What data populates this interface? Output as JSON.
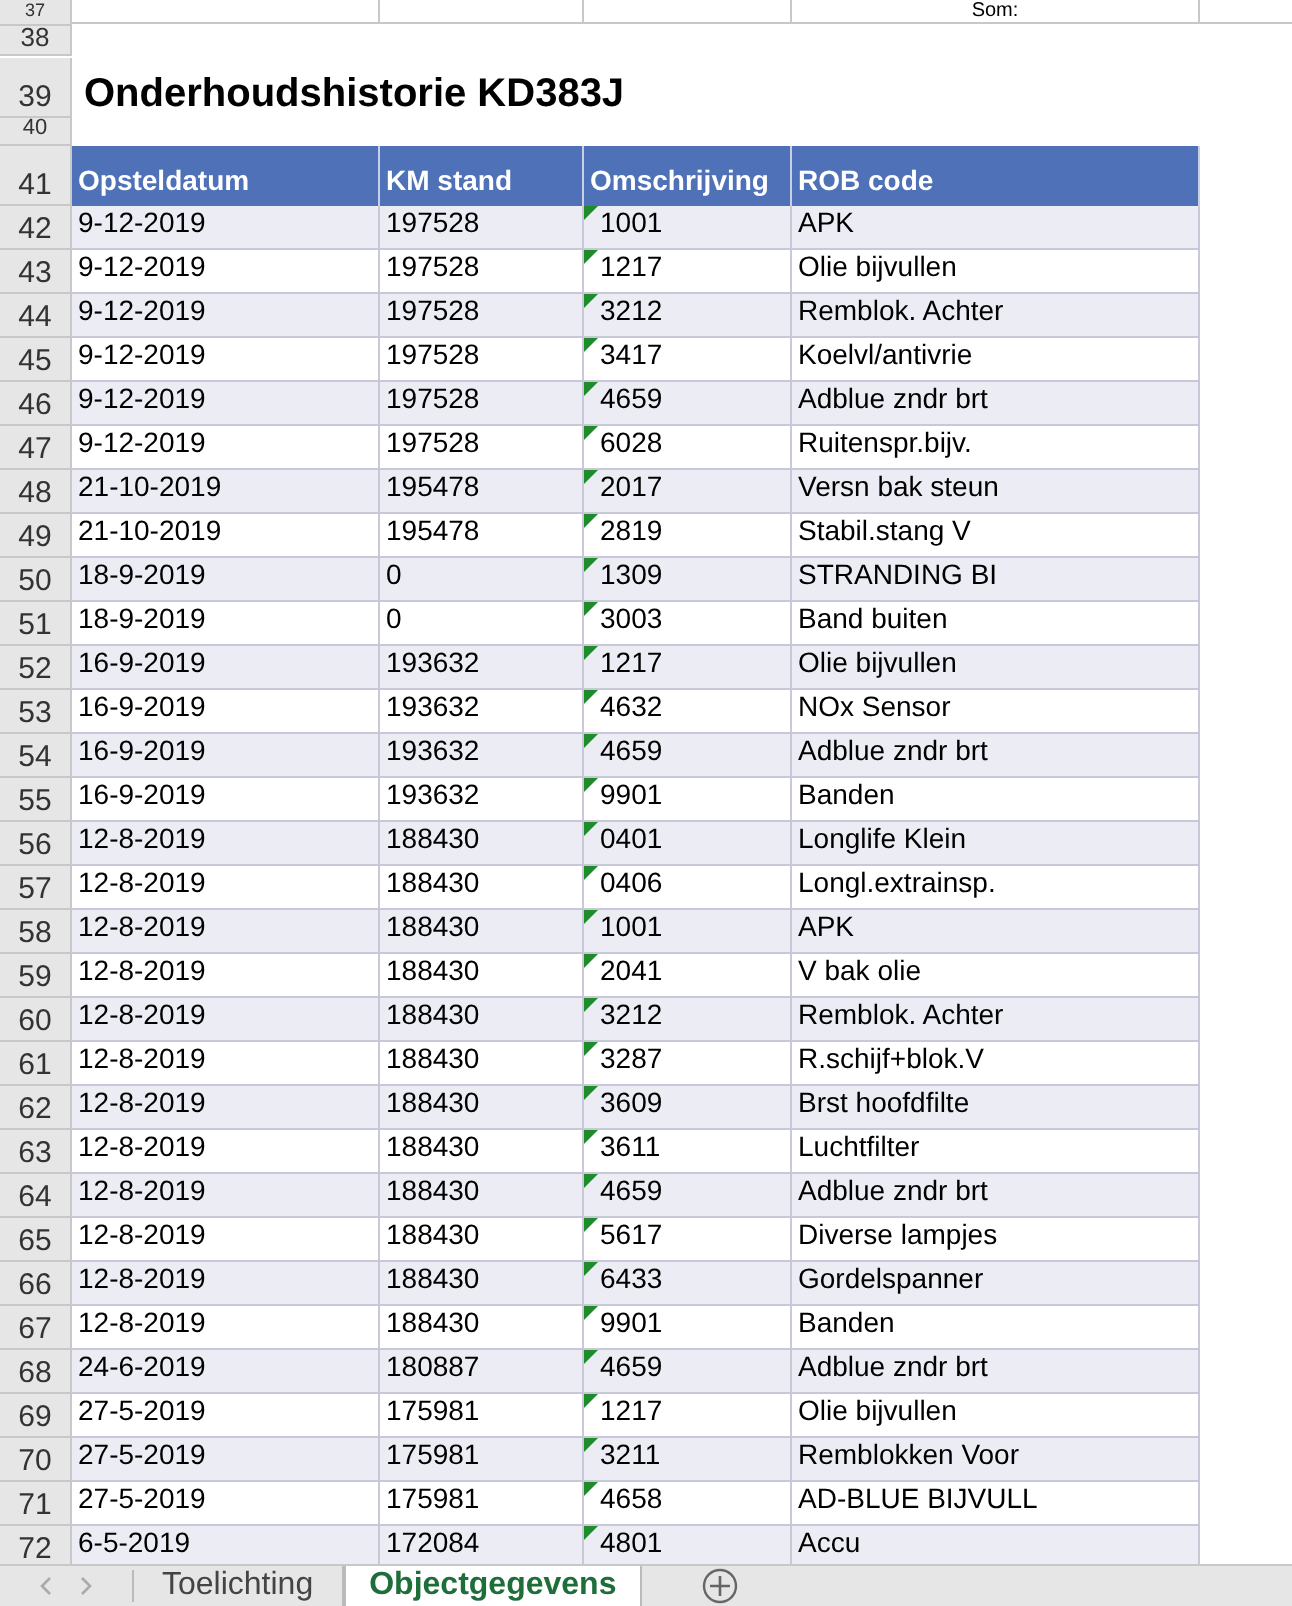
{
  "sheet": {
    "top_rows": [
      {
        "row": "37",
        "cells": [
          "",
          "",
          "",
          "Som:",
          "",
          ""
        ]
      },
      {
        "row": "38"
      }
    ],
    "title": {
      "row": "39",
      "text": "Onderhoudshistorie KD383J"
    },
    "spacer_row": "40",
    "header": {
      "row": "41",
      "columns": [
        "Opsteldatum",
        "KM stand",
        "Omschrijving",
        "ROB code"
      ]
    },
    "rows": [
      {
        "row": "42",
        "date": "9-12-2019",
        "km": "197528",
        "code": "1001",
        "rob": "APK",
        "flagged": true
      },
      {
        "row": "43",
        "date": "9-12-2019",
        "km": "197528",
        "code": "1217",
        "rob": "Olie bijvullen",
        "flagged": true
      },
      {
        "row": "44",
        "date": "9-12-2019",
        "km": "197528",
        "code": "3212",
        "rob": "Remblok. Achter",
        "flagged": true
      },
      {
        "row": "45",
        "date": "9-12-2019",
        "km": "197528",
        "code": "3417",
        "rob": "Koelvl/antivrie",
        "flagged": true
      },
      {
        "row": "46",
        "date": "9-12-2019",
        "km": "197528",
        "code": "4659",
        "rob": "Adblue zndr brt",
        "flagged": true
      },
      {
        "row": "47",
        "date": "9-12-2019",
        "km": "197528",
        "code": "6028",
        "rob": "Ruitenspr.bijv.",
        "flagged": true
      },
      {
        "row": "48",
        "date": "21-10-2019",
        "km": "195478",
        "code": "2017",
        "rob": "Versn bak steun",
        "flagged": true
      },
      {
        "row": "49",
        "date": "21-10-2019",
        "km": "195478",
        "code": "2819",
        "rob": "Stabil.stang V",
        "flagged": true
      },
      {
        "row": "50",
        "date": "18-9-2019",
        "km": "0",
        "code": "1309",
        "rob": "STRANDING BI",
        "flagged": true
      },
      {
        "row": "51",
        "date": "18-9-2019",
        "km": "0",
        "code": "3003",
        "rob": "Band buiten",
        "flagged": true
      },
      {
        "row": "52",
        "date": "16-9-2019",
        "km": "193632",
        "code": "1217",
        "rob": "Olie bijvullen",
        "flagged": true
      },
      {
        "row": "53",
        "date": "16-9-2019",
        "km": "193632",
        "code": "4632",
        "rob": "NOx Sensor",
        "flagged": true
      },
      {
        "row": "54",
        "date": "16-9-2019",
        "km": "193632",
        "code": "4659",
        "rob": "Adblue zndr brt",
        "flagged": true
      },
      {
        "row": "55",
        "date": "16-9-2019",
        "km": "193632",
        "code": "9901",
        "rob": "Banden",
        "flagged": true
      },
      {
        "row": "56",
        "date": "12-8-2019",
        "km": "188430",
        "code": "0401",
        "rob": "Longlife Klein",
        "flagged": true
      },
      {
        "row": "57",
        "date": "12-8-2019",
        "km": "188430",
        "code": "0406",
        "rob": "Longl.extrainsp.",
        "flagged": true
      },
      {
        "row": "58",
        "date": "12-8-2019",
        "km": "188430",
        "code": "1001",
        "rob": "APK",
        "flagged": true
      },
      {
        "row": "59",
        "date": "12-8-2019",
        "km": "188430",
        "code": "2041",
        "rob": "V bak olie",
        "flagged": true
      },
      {
        "row": "60",
        "date": "12-8-2019",
        "km": "188430",
        "code": "3212",
        "rob": "Remblok. Achter",
        "flagged": true
      },
      {
        "row": "61",
        "date": "12-8-2019",
        "km": "188430",
        "code": "3287",
        "rob": "R.schijf+blok.V",
        "flagged": true
      },
      {
        "row": "62",
        "date": "12-8-2019",
        "km": "188430",
        "code": "3609",
        "rob": "Brst hoofdfilte",
        "flagged": true
      },
      {
        "row": "63",
        "date": "12-8-2019",
        "km": "188430",
        "code": "3611",
        "rob": "Luchtfilter",
        "flagged": true
      },
      {
        "row": "64",
        "date": "12-8-2019",
        "km": "188430",
        "code": "4659",
        "rob": "Adblue zndr brt",
        "flagged": true
      },
      {
        "row": "65",
        "date": "12-8-2019",
        "km": "188430",
        "code": "5617",
        "rob": "Diverse lampjes",
        "flagged": true
      },
      {
        "row": "66",
        "date": "12-8-2019",
        "km": "188430",
        "code": "6433",
        "rob": "Gordelspanner",
        "flagged": true
      },
      {
        "row": "67",
        "date": "12-8-2019",
        "km": "188430",
        "code": "9901",
        "rob": "Banden",
        "flagged": true
      },
      {
        "row": "68",
        "date": "24-6-2019",
        "km": "180887",
        "code": "4659",
        "rob": "Adblue zndr brt",
        "flagged": true
      },
      {
        "row": "69",
        "date": "27-5-2019",
        "km": "175981",
        "code": "1217",
        "rob": "Olie bijvullen",
        "flagged": true
      },
      {
        "row": "70",
        "date": "27-5-2019",
        "km": "175981",
        "code": "3211",
        "rob": "Remblokken Voor",
        "flagged": true
      },
      {
        "row": "71",
        "date": "27-5-2019",
        "km": "175981",
        "code": "4658",
        "rob": "AD-BLUE BIJVULL",
        "flagged": true
      },
      {
        "row": "72",
        "date": "6-5-2019",
        "km": "172084",
        "code": "4801",
        "rob": "Accu",
        "flagged": true
      }
    ]
  },
  "sheet_tabs": [
    {
      "label": "Toelichting",
      "selected": false
    },
    {
      "label": "Objectgegevens",
      "selected": true
    }
  ]
}
